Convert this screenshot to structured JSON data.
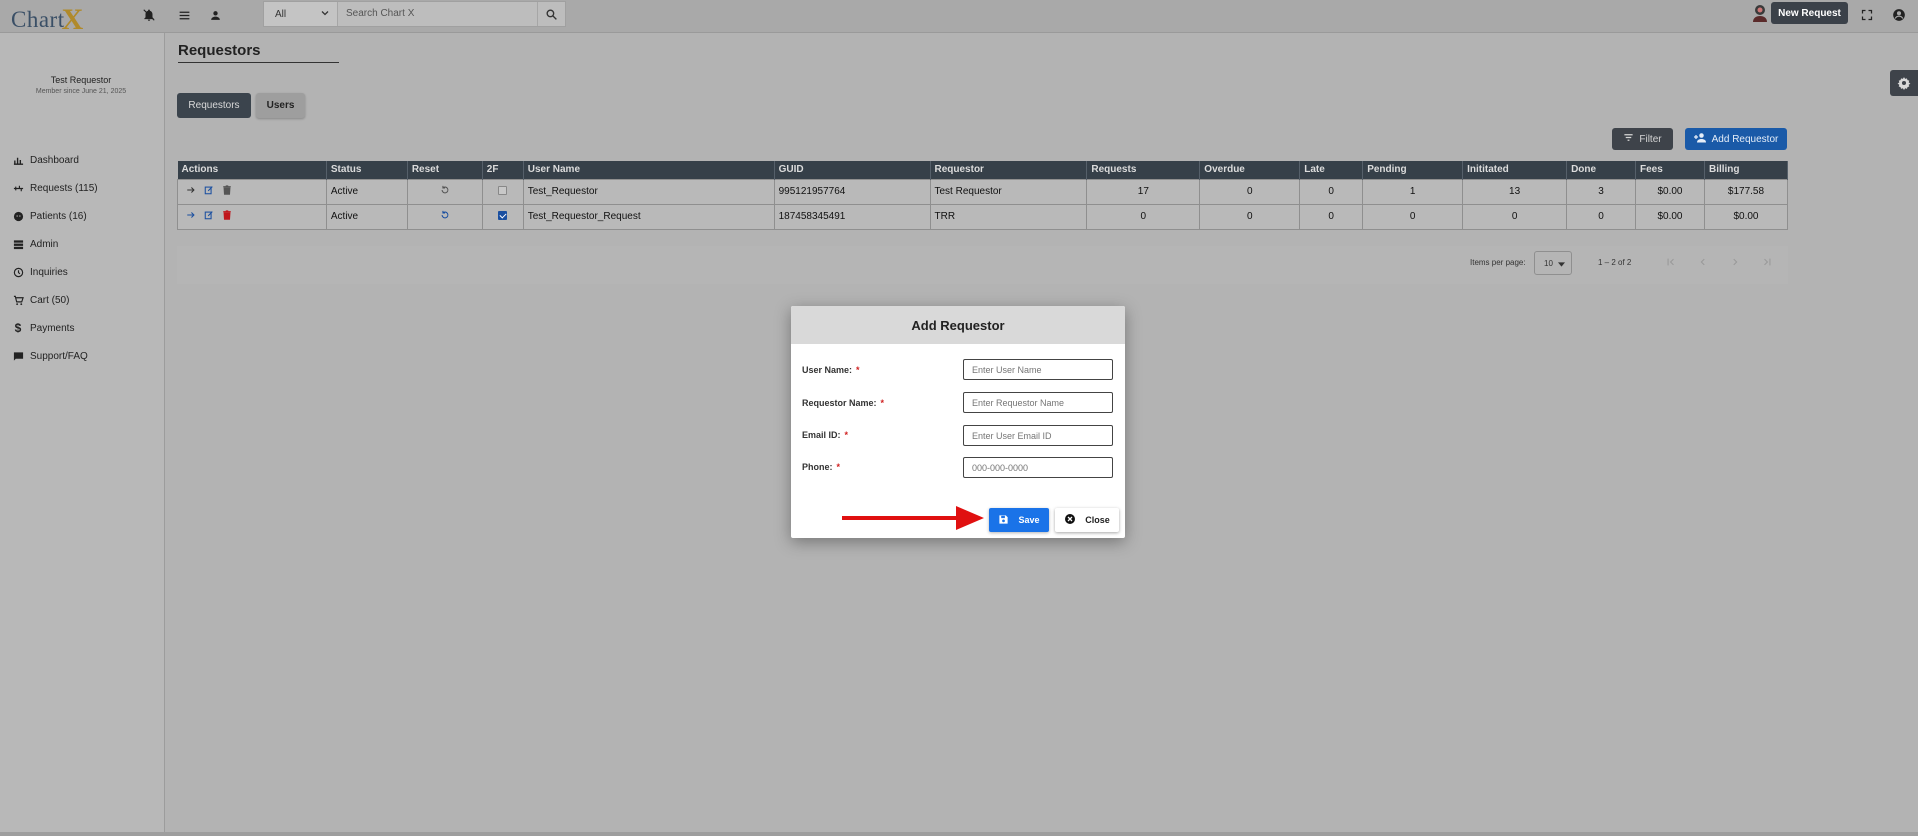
{
  "app": {
    "logo_text": "Chart",
    "logo_x": "X"
  },
  "topbar": {
    "search_scope": "All",
    "search_placeholder": "Search Chart X",
    "new_request_label": "New Request"
  },
  "sidebar": {
    "profile_name": "Test Requestor",
    "profile_since": "Member since June 21, 2025",
    "items": [
      {
        "label": "Dashboard",
        "icon": "bar-chart-icon"
      },
      {
        "label": "Requests (115)",
        "icon": "requests-icon"
      },
      {
        "label": "Patients (16)",
        "icon": "patient-face-icon"
      },
      {
        "label": "Admin",
        "icon": "storage-icon"
      },
      {
        "label": "Inquiries",
        "icon": "clock-icon"
      },
      {
        "label": "Cart (50)",
        "icon": "cart-icon"
      },
      {
        "label": "Payments",
        "icon": "dollar-icon"
      },
      {
        "label": "Support/FAQ",
        "icon": "chat-icon"
      }
    ]
  },
  "main": {
    "title": "Requestors",
    "tabs": [
      {
        "label": "Requestors",
        "active": true
      },
      {
        "label": "Users",
        "active": false
      }
    ],
    "filter_label": "Filter",
    "add_requestor_label": "Add Requestor"
  },
  "table": {
    "columns": [
      "Actions",
      "Status",
      "Reset",
      "2F",
      "User Name",
      "GUID",
      "Requestor",
      "Requests",
      "Overdue",
      "Late",
      "Pending",
      "Inititated",
      "Done",
      "Fees",
      "Billing"
    ],
    "rows": [
      {
        "status": "Active",
        "two_factor": false,
        "user_name": "Test_Requestor",
        "guid": "995121957764",
        "requestor": "Test Requestor",
        "requests": "17",
        "overdue": "0",
        "late": "0",
        "pending": "1",
        "initiated": "13",
        "done": "3",
        "fees": "$0.00",
        "billing": "$177.58"
      },
      {
        "status": "Active",
        "two_factor": true,
        "user_name": "Test_Requestor_Request",
        "guid": "187458345491",
        "requestor": "TRR",
        "requests": "0",
        "overdue": "0",
        "late": "0",
        "pending": "0",
        "initiated": "0",
        "done": "0",
        "fees": "$0.00",
        "billing": "$0.00"
      }
    ]
  },
  "paginator": {
    "items_per_page_label": "Items per page:",
    "items_per_page_value": "10",
    "range_label": "1 – 2 of 2"
  },
  "dialog": {
    "title": "Add Requestor",
    "fields": [
      {
        "label": "User Name:",
        "placeholder": "Enter User Name",
        "required_mark": "*"
      },
      {
        "label": "Requestor Name:",
        "placeholder": "Enter Requestor Name",
        "required_mark": "*"
      },
      {
        "label": "Email ID:",
        "placeholder": "Enter User Email ID",
        "required_mark": "*"
      },
      {
        "label": "Phone:",
        "placeholder": "000-000-0000",
        "required_mark": "*"
      }
    ],
    "save_label": "Save",
    "close_label": "Close"
  },
  "colors": {
    "primary_blue": "#1a73e8",
    "header_dark": "#364049",
    "annotation_arrow": "#e01010",
    "required_red": "#d02020"
  }
}
